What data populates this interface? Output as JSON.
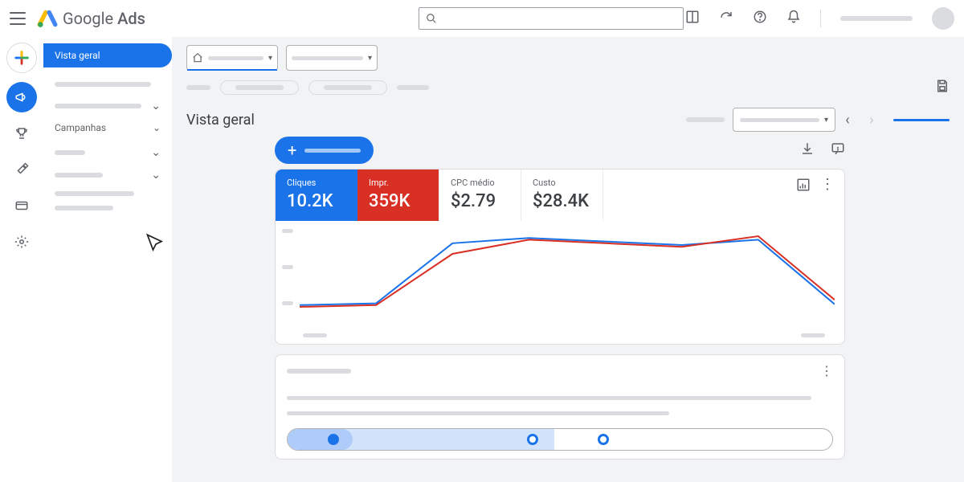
{
  "header": {
    "product": "Google",
    "product_suffix": "Ads"
  },
  "sidebar": {
    "active": "Vista geral",
    "campaigns_label": "Campanhas"
  },
  "page": {
    "title": "Vista geral"
  },
  "metrics": {
    "clicks": {
      "label": "Cliques",
      "value": "10.2K"
    },
    "impressions": {
      "label": "Impr.",
      "value": "359K"
    },
    "avg_cpc": {
      "label": "CPC médio",
      "value": "$2.79"
    },
    "cost": {
      "label": "Custo",
      "value": "$28.4K"
    }
  },
  "chart_data": {
    "type": "line",
    "x": [
      1,
      2,
      3,
      4,
      5,
      6,
      7
    ],
    "series": [
      {
        "name": "Cliques",
        "color": "#1a73e8",
        "values": [
          12,
          14,
          82,
          88,
          84,
          80,
          86,
          13
        ]
      },
      {
        "name": "Impr.",
        "color": "#d93025",
        "values": [
          10,
          12,
          70,
          86,
          82,
          78,
          90,
          18
        ]
      }
    ],
    "ylim": [
      0,
      100
    ],
    "xlabel": "",
    "ylabel": ""
  }
}
